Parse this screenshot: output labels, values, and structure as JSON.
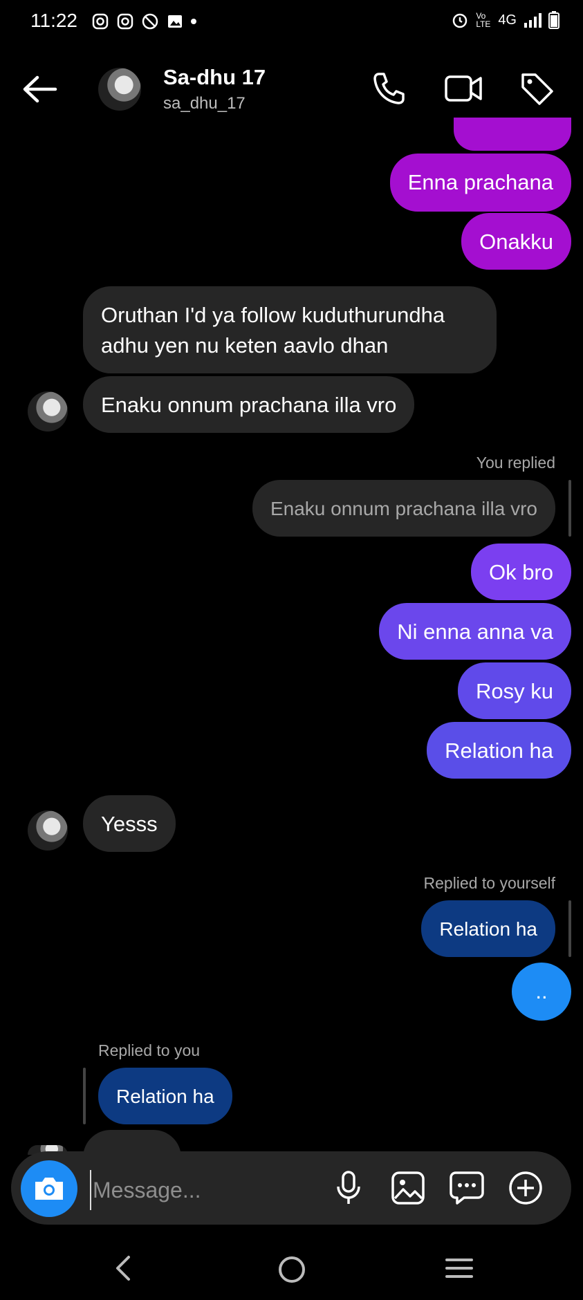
{
  "status_bar": {
    "time": "11:22",
    "network": "4G",
    "volte": "Vo LTE"
  },
  "header": {
    "name": "Sa-dhu 17",
    "username": "sa_dhu_17"
  },
  "messages": {
    "m1": "Enna prachana",
    "m2": "Onakku",
    "m3_line1": "Oruthan I'd ya follow kuduthurundha",
    "m3_line2": "adhu yen nu keten aavlo dhan",
    "m4": "Enaku onnum prachana illa vro",
    "reply_label_1": "You replied",
    "reply_quote_1": "Enaku onnum prachana illa vro",
    "m5": "Ok bro",
    "m6": "Ni enna anna va",
    "m7": "Rosy ku",
    "m8": "Relation ha",
    "m9": "Yesss",
    "reply_label_2": "Replied to yourself",
    "reply_quote_2": "Relation ha",
    "m10": "..",
    "reply_label_3": "Replied to you",
    "reply_quote_3": "Relation ha"
  },
  "composer": {
    "placeholder": "Message..."
  },
  "colors": {
    "purple": "#a40fd0",
    "violet": "#7b3ff0",
    "indigo": "#5a4ee8",
    "grey_bubble": "#262626",
    "blue": "#1d8cf5",
    "dark_blue": "#0d3a82"
  }
}
